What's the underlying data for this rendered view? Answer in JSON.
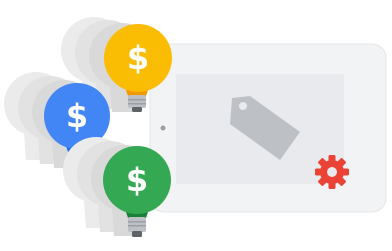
{
  "illustration": {
    "bulbs": [
      {
        "id": "yellow",
        "symbol": "$",
        "color": "#FBBC04"
      },
      {
        "id": "blue",
        "symbol": "$",
        "color": "#4285F4"
      },
      {
        "id": "green",
        "symbol": "$",
        "color": "#34A853"
      }
    ],
    "tablet": {
      "frame_color": "#F1F3F4",
      "screen_color": "#E8EAED",
      "tag_color": "#BDC1C6",
      "gear_color": "#EA4335"
    }
  }
}
